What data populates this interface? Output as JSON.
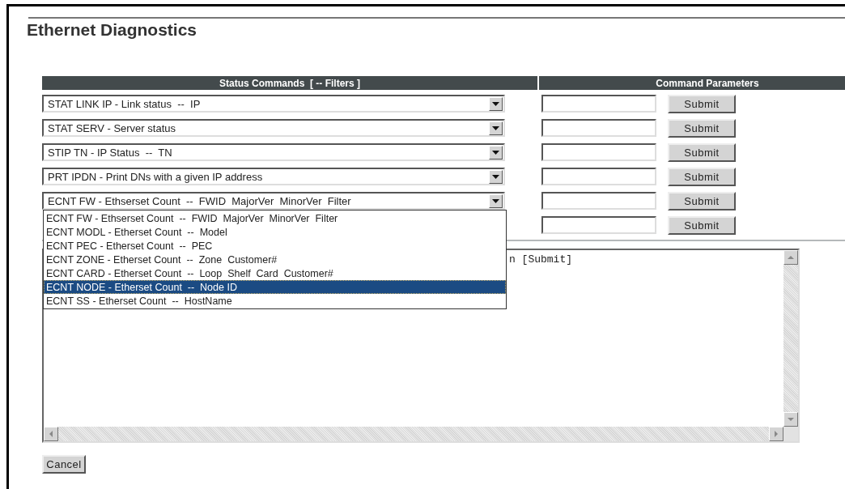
{
  "title": "Ethernet Diagnostics",
  "table": {
    "columns": [
      "Status Commands  [ -- Filters ]",
      "Command Parameters"
    ],
    "rows": [
      {
        "command": "STAT LINK IP - Link status  --  IP",
        "button": "Submit"
      },
      {
        "command": "STAT SERV - Server status",
        "button": "Submit"
      },
      {
        "command": "STIP TN - IP Status  --  TN",
        "button": "Submit"
      },
      {
        "command": "PRT IPDN - Print DNs with a given IP address",
        "button": "Submit"
      },
      {
        "command": "ECNT FW - Ethserset Count  --  FWID  MajorVer  MinorVer  Filter",
        "button": "Submit",
        "expanded": true
      },
      {
        "button": "Submit"
      }
    ]
  },
  "dropdown": {
    "options": [
      {
        "label": "ECNT FW - Ethserset Count  --  FWID  MajorVer  MinorVer  Filter",
        "selected": false
      },
      {
        "label": "ECNT MODL - Etherset Count  --  Model",
        "selected": false
      },
      {
        "label": "ECNT PEC - Etherset Count  --  PEC",
        "selected": false
      },
      {
        "label": "ECNT ZONE - Etherset Count  --  Zone  Customer#",
        "selected": false
      },
      {
        "label": "ECNT CARD - Etherset Count  --  Loop  Shelf  Card  Customer#",
        "selected": false
      },
      {
        "label": "ECNT NODE - Etherset Count  --  Node ID",
        "selected": true
      },
      {
        "label": "ECNT SS - Etherset Count  --  HostName",
        "selected": false
      }
    ]
  },
  "output": {
    "text": "n [Submit]"
  },
  "cancel_button": "Cancel"
}
